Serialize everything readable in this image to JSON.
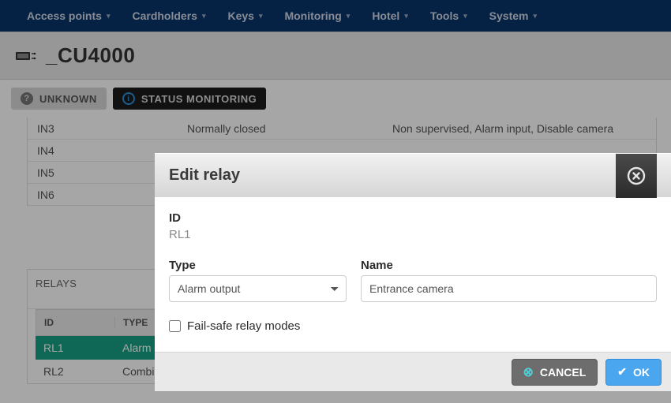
{
  "nav": {
    "items": [
      "Access points",
      "Cardholders",
      "Keys",
      "Monitoring",
      "Hotel",
      "Tools",
      "System"
    ]
  },
  "page": {
    "title": "_CU4000"
  },
  "badges": {
    "unknown": "UNKNOWN",
    "status": "STATUS MONITORING"
  },
  "inputs_table": {
    "rows": [
      {
        "id": "IN3",
        "mode": "Normally closed",
        "desc": "Non supervised, Alarm input, Disable camera"
      },
      {
        "id": "IN4",
        "mode": "",
        "desc": ""
      },
      {
        "id": "IN5",
        "mode": "",
        "desc": ""
      },
      {
        "id": "IN6",
        "mode": "",
        "desc": ""
      }
    ]
  },
  "relays": {
    "title": "RELAYS",
    "headers": {
      "id": "ID",
      "type": "TYPE"
    },
    "rows": [
      {
        "id": "RL1",
        "type": "Alarm o"
      },
      {
        "id": "RL2",
        "type": "Combin"
      }
    ]
  },
  "modal": {
    "title": "Edit relay",
    "id_label": "ID",
    "id_value": "RL1",
    "type_label": "Type",
    "type_value": "Alarm output",
    "name_label": "Name",
    "name_value": "Entrance camera",
    "failsafe_label": "Fail-safe relay modes",
    "cancel": "CANCEL",
    "ok": "OK"
  }
}
